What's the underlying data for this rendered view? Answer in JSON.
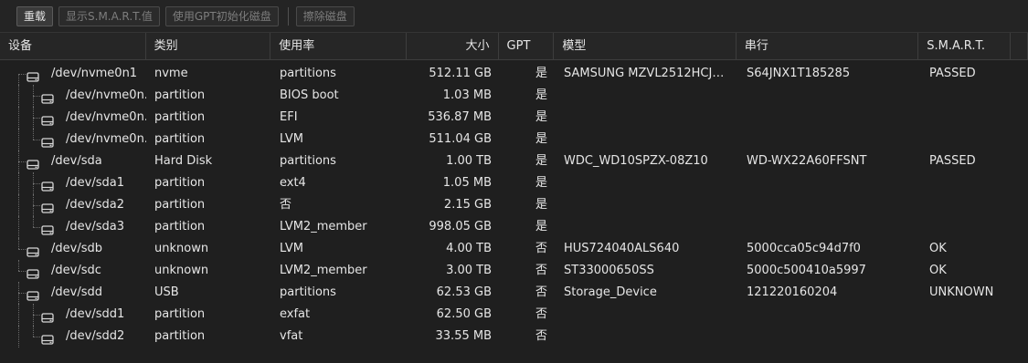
{
  "toolbar": {
    "reload": "重载",
    "smart": "显示S.M.A.R.T.值",
    "gpt_init": "使用GPT初始化磁盘",
    "wipe": "擦除磁盘"
  },
  "columns": [
    "设备",
    "类别",
    "使用率",
    "大小",
    "GPT",
    "模型",
    "串行",
    "S.M.A.R.T."
  ],
  "rows": [
    {
      "device": "/dev/nvme0n1",
      "type": "nvme",
      "usage": "partitions",
      "size": "512.11 GB",
      "gpt": "是",
      "model": "SAMSUNG MZVL2512HCJQ...",
      "serial": "S64JNX1T185285",
      "smart": "PASSED",
      "child": false,
      "last": false
    },
    {
      "device": "/dev/nvme0n...",
      "type": "partition",
      "usage": "BIOS boot",
      "size": "1.03 MB",
      "gpt": "是",
      "model": "",
      "serial": "",
      "smart": "",
      "child": true,
      "last": false
    },
    {
      "device": "/dev/nvme0n...",
      "type": "partition",
      "usage": "EFI",
      "size": "536.87 MB",
      "gpt": "是",
      "model": "",
      "serial": "",
      "smart": "",
      "child": true,
      "last": false
    },
    {
      "device": "/dev/nvme0n...",
      "type": "partition",
      "usage": "LVM",
      "size": "511.04 GB",
      "gpt": "是",
      "model": "",
      "serial": "",
      "smart": "",
      "child": true,
      "last": true
    },
    {
      "device": "/dev/sda",
      "type": "Hard Disk",
      "usage": "partitions",
      "size": "1.00 TB",
      "gpt": "是",
      "model": "WDC_WD10SPZX-08Z10",
      "serial": "WD-WX22A60FFSNT",
      "smart": "PASSED",
      "child": false,
      "last": false
    },
    {
      "device": "/dev/sda1",
      "type": "partition",
      "usage": "ext4",
      "size": "1.05 MB",
      "gpt": "是",
      "model": "",
      "serial": "",
      "smart": "",
      "child": true,
      "last": false
    },
    {
      "device": "/dev/sda2",
      "type": "partition",
      "usage": "否",
      "size": "2.15 GB",
      "gpt": "是",
      "model": "",
      "serial": "",
      "smart": "",
      "child": true,
      "last": false
    },
    {
      "device": "/dev/sda3",
      "type": "partition",
      "usage": "LVM2_member",
      "size": "998.05 GB",
      "gpt": "是",
      "model": "",
      "serial": "",
      "smart": "",
      "child": true,
      "last": true
    },
    {
      "device": "/dev/sdb",
      "type": "unknown",
      "usage": "LVM",
      "size": "4.00 TB",
      "gpt": "否",
      "model": "HUS724040ALS640",
      "serial": "5000cca05c94d7f0",
      "smart": "OK",
      "child": false,
      "last": false
    },
    {
      "device": "/dev/sdc",
      "type": "unknown",
      "usage": "LVM2_member",
      "size": "3.00 TB",
      "gpt": "否",
      "model": "ST33000650SS",
      "serial": "5000c500410a5997",
      "smart": "OK",
      "child": false,
      "last": false
    },
    {
      "device": "/dev/sdd",
      "type": "USB",
      "usage": "partitions",
      "size": "62.53 GB",
      "gpt": "否",
      "model": "Storage_Device",
      "serial": "121220160204",
      "smart": "UNKNOWN",
      "child": false,
      "last": false
    },
    {
      "device": "/dev/sdd1",
      "type": "partition",
      "usage": "exfat",
      "size": "62.50 GB",
      "gpt": "否",
      "model": "",
      "serial": "",
      "smart": "",
      "child": true,
      "last": false
    },
    {
      "device": "/dev/sdd2",
      "type": "partition",
      "usage": "vfat",
      "size": "33.55 MB",
      "gpt": "否",
      "model": "",
      "serial": "",
      "smart": "",
      "child": true,
      "last": true
    }
  ],
  "colors": {
    "background": "#1f1f1f",
    "text": "#e4e4e4",
    "border": "#3d3d3d"
  },
  "icons": {
    "disk": "hard-disk-icon"
  }
}
